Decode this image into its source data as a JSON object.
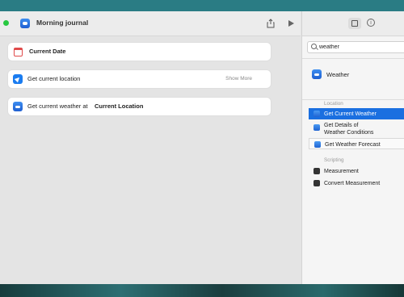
{
  "window": {
    "title": "Morning journal"
  },
  "actions": [
    {
      "pill": "Current Date"
    },
    {
      "text": "Get current location",
      "extra": "Show More"
    },
    {
      "text": "Get current weather at",
      "pill": "Current Location"
    }
  ],
  "sidebar": {
    "search_value": "weather",
    "app_label": "Weather",
    "sections": [
      {
        "header": "Location",
        "items": [
          "Get Current Weather",
          "Get Details of\nWeather Conditions",
          "Get Weather Forecast"
        ]
      },
      {
        "header": "Scripting",
        "items": [
          "Measurement",
          "Convert Measurement"
        ]
      }
    ]
  },
  "colors": {
    "accent": "#1a6fe0",
    "pill": "#1a73e8"
  }
}
